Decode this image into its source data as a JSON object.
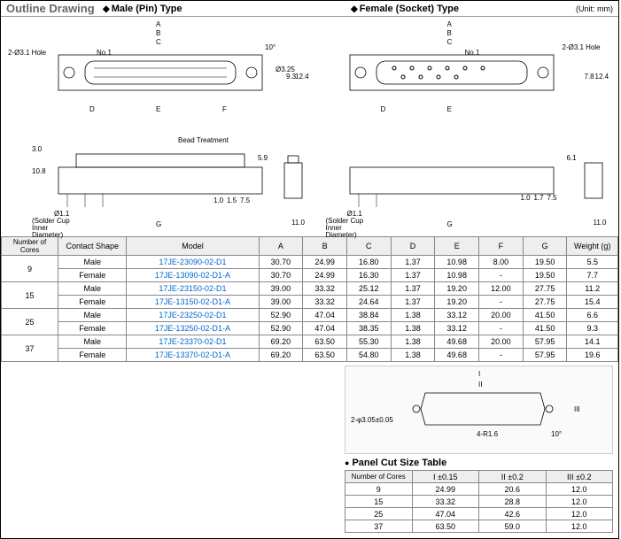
{
  "header": {
    "outline_title": "Outline Drawing",
    "male_label": "Male (Pin) Type",
    "female_label": "Female (Socket) Type",
    "unit": "(Unit: mm)"
  },
  "drawing_labels": {
    "hole": "2-Ø3.1 Hole",
    "no1": "No.1",
    "bead": "Bead Treatment",
    "solder": "(Solder Cup Inner Diameter)",
    "diam": "Ø1.1",
    "ten_deg": "10°",
    "A": "A",
    "B": "B",
    "C": "C",
    "D": "D",
    "E": "E",
    "F": "F",
    "G": "G",
    "d30": "3.0",
    "d108": "10.8",
    "d11": "11.0",
    "d10": "1.0",
    "d15": "1.5",
    "d75": "7.5",
    "d59": "5.9",
    "d93": "9.3",
    "d124": "12.4",
    "d325": "Ø3.25",
    "d61": "6.1",
    "d78": "7.8",
    "d17": "1.7"
  },
  "main_table": {
    "headers": {
      "cores": "Number of Cores",
      "shape": "Contact Shape",
      "model": "Model",
      "A": "A",
      "B": "B",
      "C": "C",
      "D": "D",
      "E": "E",
      "F": "F",
      "G": "G",
      "weight": "Weight (g)"
    },
    "groups": [
      {
        "cores": "9",
        "rows": [
          {
            "shape": "Male",
            "model": "17JE-23090-02-D1",
            "A": "30.70",
            "B": "24.99",
            "C": "16.80",
            "D": "1.37",
            "E": "10.98",
            "F": "8.00",
            "G": "19.50",
            "W": "5.5"
          },
          {
            "shape": "Female",
            "model": "17JE-13090-02-D1-A",
            "A": "30.70",
            "B": "24.99",
            "C": "16.30",
            "D": "1.37",
            "E": "10.98",
            "F": "-",
            "G": "19.50",
            "W": "7.7"
          }
        ]
      },
      {
        "cores": "15",
        "rows": [
          {
            "shape": "Male",
            "model": "17JE-23150-02-D1",
            "A": "39.00",
            "B": "33.32",
            "C": "25.12",
            "D": "1.37",
            "E": "19.20",
            "F": "12.00",
            "G": "27.75",
            "W": "11.2"
          },
          {
            "shape": "Female",
            "model": "17JE-13150-02-D1-A",
            "A": "39.00",
            "B": "33.32",
            "C": "24.64",
            "D": "1.37",
            "E": "19.20",
            "F": "-",
            "G": "27.75",
            "W": "15.4"
          }
        ]
      },
      {
        "cores": "25",
        "rows": [
          {
            "shape": "Male",
            "model": "17JE-23250-02-D1",
            "A": "52.90",
            "B": "47.04",
            "C": "38.84",
            "D": "1.38",
            "E": "33.12",
            "F": "20.00",
            "G": "41.50",
            "W": "6.6"
          },
          {
            "shape": "Female",
            "model": "17JE-13250-02-D1-A",
            "A": "52.90",
            "B": "47.04",
            "C": "38.35",
            "D": "1.38",
            "E": "33.12",
            "F": "-",
            "G": "41.50",
            "W": "9.3"
          }
        ]
      },
      {
        "cores": "37",
        "rows": [
          {
            "shape": "Male",
            "model": "17JE-23370-02-D1",
            "A": "69.20",
            "B": "63.50",
            "C": "55.30",
            "D": "1.38",
            "E": "49.68",
            "F": "20.00",
            "G": "57.95",
            "W": "14.1"
          },
          {
            "shape": "Female",
            "model": "17JE-13370-02-D1-A",
            "A": "69.20",
            "B": "63.50",
            "C": "54.80",
            "D": "1.38",
            "E": "49.68",
            "F": "-",
            "G": "57.95",
            "W": "19.6"
          }
        ]
      }
    ]
  },
  "panel_drawing": {
    "dim_I": "I",
    "dim_II": "II",
    "dim_III": "III",
    "hole": "2-φ3.05±0.05",
    "radius": "4-R1.6",
    "angle": "10°"
  },
  "panel_table": {
    "title": "Panel Cut Size Table",
    "headers": {
      "cores": "Number of Cores",
      "I": "I ±0.15",
      "II": "II ±0.2",
      "III": "III ±0.2"
    },
    "rows": [
      {
        "cores": "9",
        "I": "24.99",
        "II": "20.6",
        "III": "12.0"
      },
      {
        "cores": "15",
        "I": "33.32",
        "II": "28.8",
        "III": "12.0"
      },
      {
        "cores": "25",
        "I": "47.04",
        "II": "42.6",
        "III": "12.0"
      },
      {
        "cores": "37",
        "I": "63.50",
        "II": "59.0",
        "III": "12.0"
      }
    ]
  }
}
